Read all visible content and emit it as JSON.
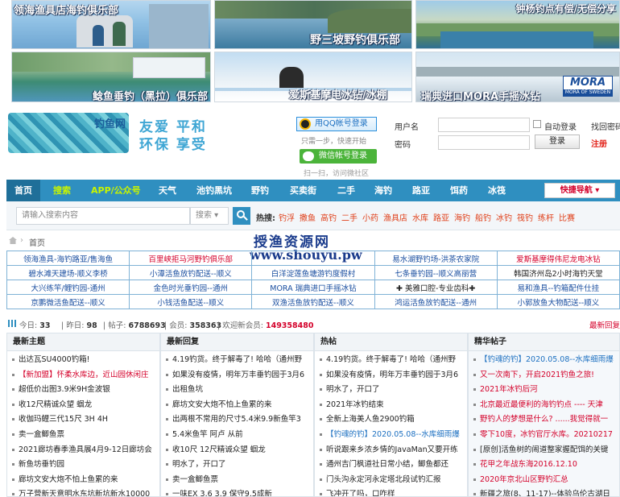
{
  "banners": [
    {
      "caption": "领海渔具店海钓俱乐部"
    },
    {
      "caption": "野三坡野钓俱乐部"
    },
    {
      "caption": "钟杨钓点有偿/无偿分享"
    },
    {
      "caption": "鲶鱼垂钓（黑拉）俱乐部"
    },
    {
      "caption": "爱斯基摩电冰钻/冰棚"
    },
    {
      "caption": "瑞典进口MORA手摇冰钻",
      "logo_text": "MORA",
      "logo_sub": "MORA OF SWEDEN"
    }
  ],
  "header": {
    "logo_text": "钓鱼网",
    "slogan_line1": "友爱 平和",
    "slogan_line2": "环保 享受",
    "qq_login": "用QQ帐号登录",
    "login_hint": "只需一步，快速开始",
    "wechat_login": "微信帐号登录",
    "scan_hint": "扫一扫，访问微社区",
    "username_label": "用户名",
    "password_label": "密码",
    "auto_login": "自动登录",
    "forgot": "找回密码",
    "login_button": "登录",
    "register": "注册"
  },
  "nav": {
    "items": [
      "首页",
      "搜索",
      "APP/公众号",
      "天气",
      "池钓黑坑",
      "野钓",
      "买卖街",
      "二手",
      "海钓",
      "路亚",
      "饵药",
      "冰筏"
    ],
    "quick_nav": "快捷导航"
  },
  "search": {
    "placeholder": "请输入搜索内容",
    "scope": "搜索",
    "hot_label": "热搜:",
    "hot_keywords": [
      "钓浮",
      "撒鱼",
      "高钓",
      "二手",
      "小药",
      "渔具店",
      "水库",
      "路亚",
      "海钓",
      "船钓",
      "冰钓",
      "筏钓",
      "练杆",
      "比赛"
    ]
  },
  "breadcrumb": {
    "home": "首页"
  },
  "watermark": {
    "line1": "授渔资源网",
    "line2": "www.shouyu.pw"
  },
  "link_table": [
    [
      "领海渔具-海钓路亚/售海鱼",
      "百里峡拒马河野钓俱乐部",
      "",
      "易水湖野钓场-洪茶农家院",
      "爱斯基摩得伟尼龙电冰钻"
    ],
    [
      "碧水滩天建场-顺义李桥",
      "小潭活鱼放钓配送--顺义",
      "白洋淀莲鱼塘游钓度假村",
      "七条垂钓园--顺义高丽营",
      "韩国济州岛2小时海钓天堂"
    ],
    [
      "大兴练竿/鲤钓园-通州",
      "金色时光垂钓园--通州",
      "MORA 瑞典进口手摇冰钻",
      "✚ 美雅口腔-专业齿科✚",
      "易和渔具--钓箱配件仕挂"
    ],
    [
      "京鹏微活鱼配送--顺义",
      "小钱活鱼配送--顺义",
      "双渔活鱼放钓配送--顺义",
      "鸿运活鱼放钓配送--通州",
      "小郭放鱼大物配送--顺义"
    ]
  ],
  "stats": {
    "today_label": "今日:",
    "today": "33",
    "yesterday_label": "昨日:",
    "yesterday": "98",
    "posts_label": "帖子:",
    "posts": "6788693",
    "members_label": "会员:",
    "members": "358363",
    "welcome_label": "欢迎新会员:",
    "newest": "149358480",
    "latest_reply": "最新回复"
  },
  "columns": [
    {
      "title": "最新主题",
      "items": [
        {
          "text": "出达瓦SU4000钓箱!",
          "style": ""
        },
        {
          "text": "【新加盟】怀柔水库边，近山园休闲庄",
          "style": "red"
        },
        {
          "text": "超低价出图3.9米9H金波银",
          "style": ""
        },
        {
          "text": "收12尺精诚众望 蝈龙",
          "style": ""
        },
        {
          "text": "收伽玛鲤三代15尺 3H 4H",
          "style": ""
        },
        {
          "text": "卖一盒鲫鱼票",
          "style": ""
        },
        {
          "text": "2021廊坊春季渔具展4月9-12日廊坊会",
          "style": ""
        },
        {
          "text": "新鱼坊垂钓园",
          "style": ""
        },
        {
          "text": "廊坊文安大炮不怕上鱼累的来",
          "style": ""
        },
        {
          "text": "万子营新天意明水东坑新坑新水10000",
          "style": ""
        }
      ]
    },
    {
      "title": "最新回复",
      "items": [
        {
          "text": "4.19钓货。终于解毒了! 哈哈（通州野",
          "style": ""
        },
        {
          "text": "如果没有疫情，明年万丰垂钓园于3月6",
          "style": ""
        },
        {
          "text": "出租鱼坑",
          "style": ""
        },
        {
          "text": "廊坊文安大炮不怕上鱼累的来",
          "style": ""
        },
        {
          "text": "出两根不常用的尺寸5.4米9.9新鱼竿3",
          "style": ""
        },
        {
          "text": "5.4米鱼竿 阿卢 从前",
          "style": ""
        },
        {
          "text": "收10尺 12尺精诚众望 蝈龙",
          "style": ""
        },
        {
          "text": "明水了，开口了",
          "style": ""
        },
        {
          "text": "卖一盒鲫鱼票",
          "style": ""
        },
        {
          "text": "一味EX 3.6 3.9 保守9.5成新",
          "style": ""
        }
      ]
    },
    {
      "title": "热帖",
      "items": [
        {
          "text": "4.19钓货。终于解毒了! 哈哈（通州野",
          "style": ""
        },
        {
          "text": "如果没有疫情，明年万丰垂钓园于3月6",
          "style": ""
        },
        {
          "text": "明水了，开口了",
          "style": ""
        },
        {
          "text": "2021年冰钓结束",
          "style": ""
        },
        {
          "text": "全新上海美人鱼2900钓箱",
          "style": ""
        },
        {
          "text": "【钓魂的钓】2020.05.08--水库细雨爆",
          "style": "blue"
        },
        {
          "text": "听说跟来乡浓乡情的JavaMan又要开练",
          "style": ""
        },
        {
          "text": "通州吉门枫道社日常小结，鲫鱼都还",
          "style": ""
        },
        {
          "text": "门头沟永定河永定塔北段试钓汇报",
          "style": ""
        },
        {
          "text": "飞冲开了吗，口咋样",
          "style": ""
        }
      ]
    },
    {
      "title": "精华帖子",
      "items": [
        {
          "text": "【钓魂的钓】2020.05.08--水库细雨爆",
          "style": "blue"
        },
        {
          "text": "又一次南下，开启2021钓鱼之旅!",
          "style": "red"
        },
        {
          "text": "2021年冰钓后河",
          "style": "red"
        },
        {
          "text": "北京最近最便利的海钓钓点 ---- 天津",
          "style": "red"
        },
        {
          "text": "野钓人的梦想是什么? ......我觉得就一",
          "style": "red"
        },
        {
          "text": "零下10度，冰钓官厅水库。20210217",
          "style": "red"
        },
        {
          "text": "[原创]活鱼树的闹道整家握配饵的关键",
          "style": ""
        },
        {
          "text": "花甲之年战东海2016.12.10",
          "style": "red"
        },
        {
          "text": "2020年京北山区野钓汇总",
          "style": "red"
        },
        {
          "text": "新疆之旅(8、11-17)--体验乌伦古湖日",
          "style": ""
        }
      ]
    }
  ]
}
